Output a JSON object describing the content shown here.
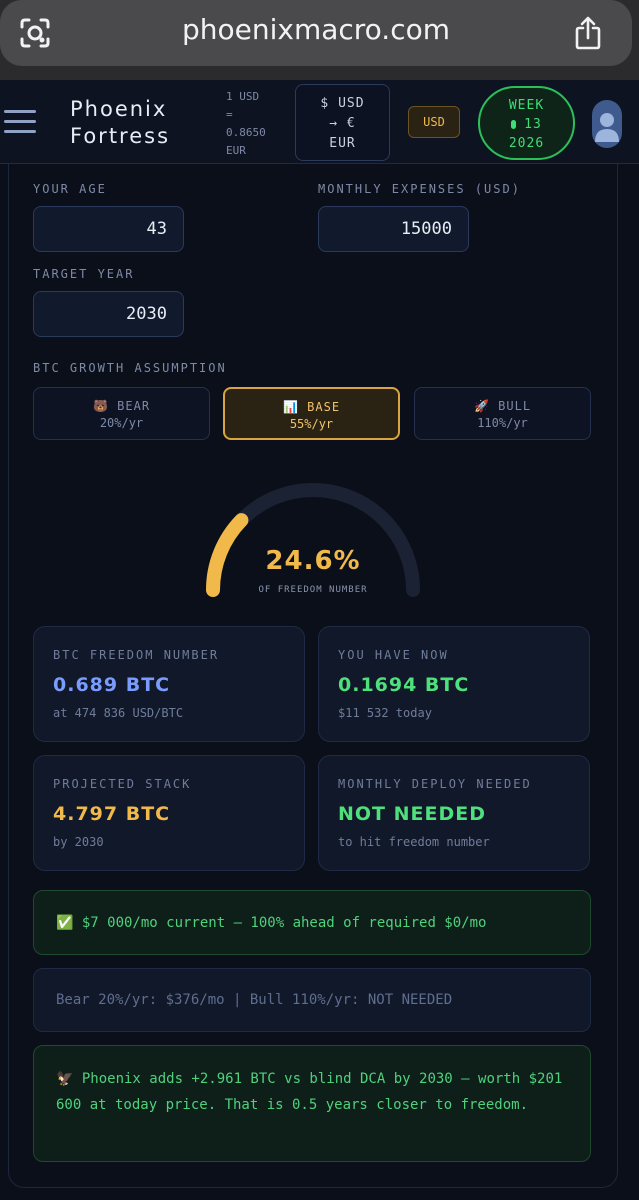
{
  "browser": {
    "url": "phoenixmacro.com"
  },
  "header": {
    "brand_line1": "Phoenix",
    "brand_line2": "Fortress",
    "rate_line1": "1 USD",
    "rate_line2": "=",
    "rate_line3": "0.8650",
    "rate_line4": "EUR",
    "convert_line1": "$ USD",
    "convert_line2": "→ €",
    "convert_line3": "EUR",
    "currency_badge": "USD",
    "week_line1": "WEEK",
    "week_line2": "13",
    "week_line3": "2026"
  },
  "form": {
    "age_label": "YOUR AGE",
    "age_value": "43",
    "expenses_label": "MONTHLY EXPENSES (USD)",
    "expenses_value": "15000",
    "target_label": "TARGET YEAR",
    "target_value": "2030",
    "growth_label": "BTC GROWTH ASSUMPTION"
  },
  "scenarios": [
    {
      "icon": "🐻",
      "name": "BEAR",
      "rate": "20%/yr",
      "selected": false
    },
    {
      "icon": "📊",
      "name": "BASE",
      "rate": "55%/yr",
      "selected": true
    },
    {
      "icon": "🚀",
      "name": "BULL",
      "rate": "110%/yr",
      "selected": false
    }
  ],
  "gauge": {
    "value_text": "24.6%",
    "fraction": 0.246,
    "caption": "OF FREEDOM NUMBER",
    "fill_color": "#f0b94a",
    "track_color": "#1a2233"
  },
  "stats": {
    "freedom_label": "BTC FREEDOM NUMBER",
    "freedom_value": "0.689 BTC",
    "freedom_sub": "at 474 836 USD/BTC",
    "have_label": "YOU HAVE NOW",
    "have_value": "0.1694 BTC",
    "have_sub": "$11 532 today",
    "projected_label": "PROJECTED STACK",
    "projected_value": "4.797 BTC",
    "projected_sub": "by 2030",
    "deploy_label": "MONTHLY DEPLOY NEEDED",
    "deploy_value": "NOT NEEDED",
    "deploy_sub": "to hit freedom number"
  },
  "notes": {
    "ahead": "✅ $7 000/mo current — 100% ahead of required $0/mo",
    "scenarios": "Bear 20%/yr: $376/mo | Bull 110%/yr: NOT NEEDED",
    "phoenix": "🦅 Phoenix adds +2.961 BTC vs blind DCA by 2030 — worth $201 600 at today price. That is 0.5 years closer to freedom."
  },
  "colors": {
    "blue": "#7b9cff",
    "green": "#4ee07a",
    "gold": "#f0b94a"
  }
}
